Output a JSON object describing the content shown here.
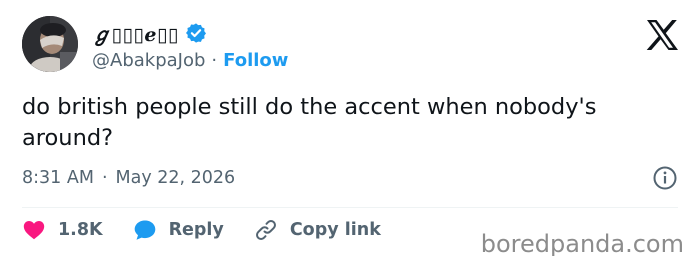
{
  "author": {
    "display_name": "ℊ▯▯▯e▯▯",
    "handle": "@AbakpaJob",
    "separator": "·",
    "follow_label": "Follow",
    "verified_color": "#1d9bf0"
  },
  "tweet": {
    "text": "do british people still do the accent when nobody's around?",
    "time": "8:31 AM",
    "separator": "·",
    "date": "May 22, 2026"
  },
  "actions": {
    "likes_count": "1.8K",
    "reply_label": "Reply",
    "copy_link_label": "Copy link"
  },
  "icons": {
    "like": "heart-icon",
    "reply": "speech-bubble-icon",
    "copy": "link-icon",
    "info": "info-icon",
    "logo": "x-logo-icon"
  },
  "colors": {
    "like": "#f91880",
    "reply": "#1d9bf0",
    "follow": "#1d9bf0",
    "muted": "#536471"
  },
  "watermark": "boredpanda.com"
}
